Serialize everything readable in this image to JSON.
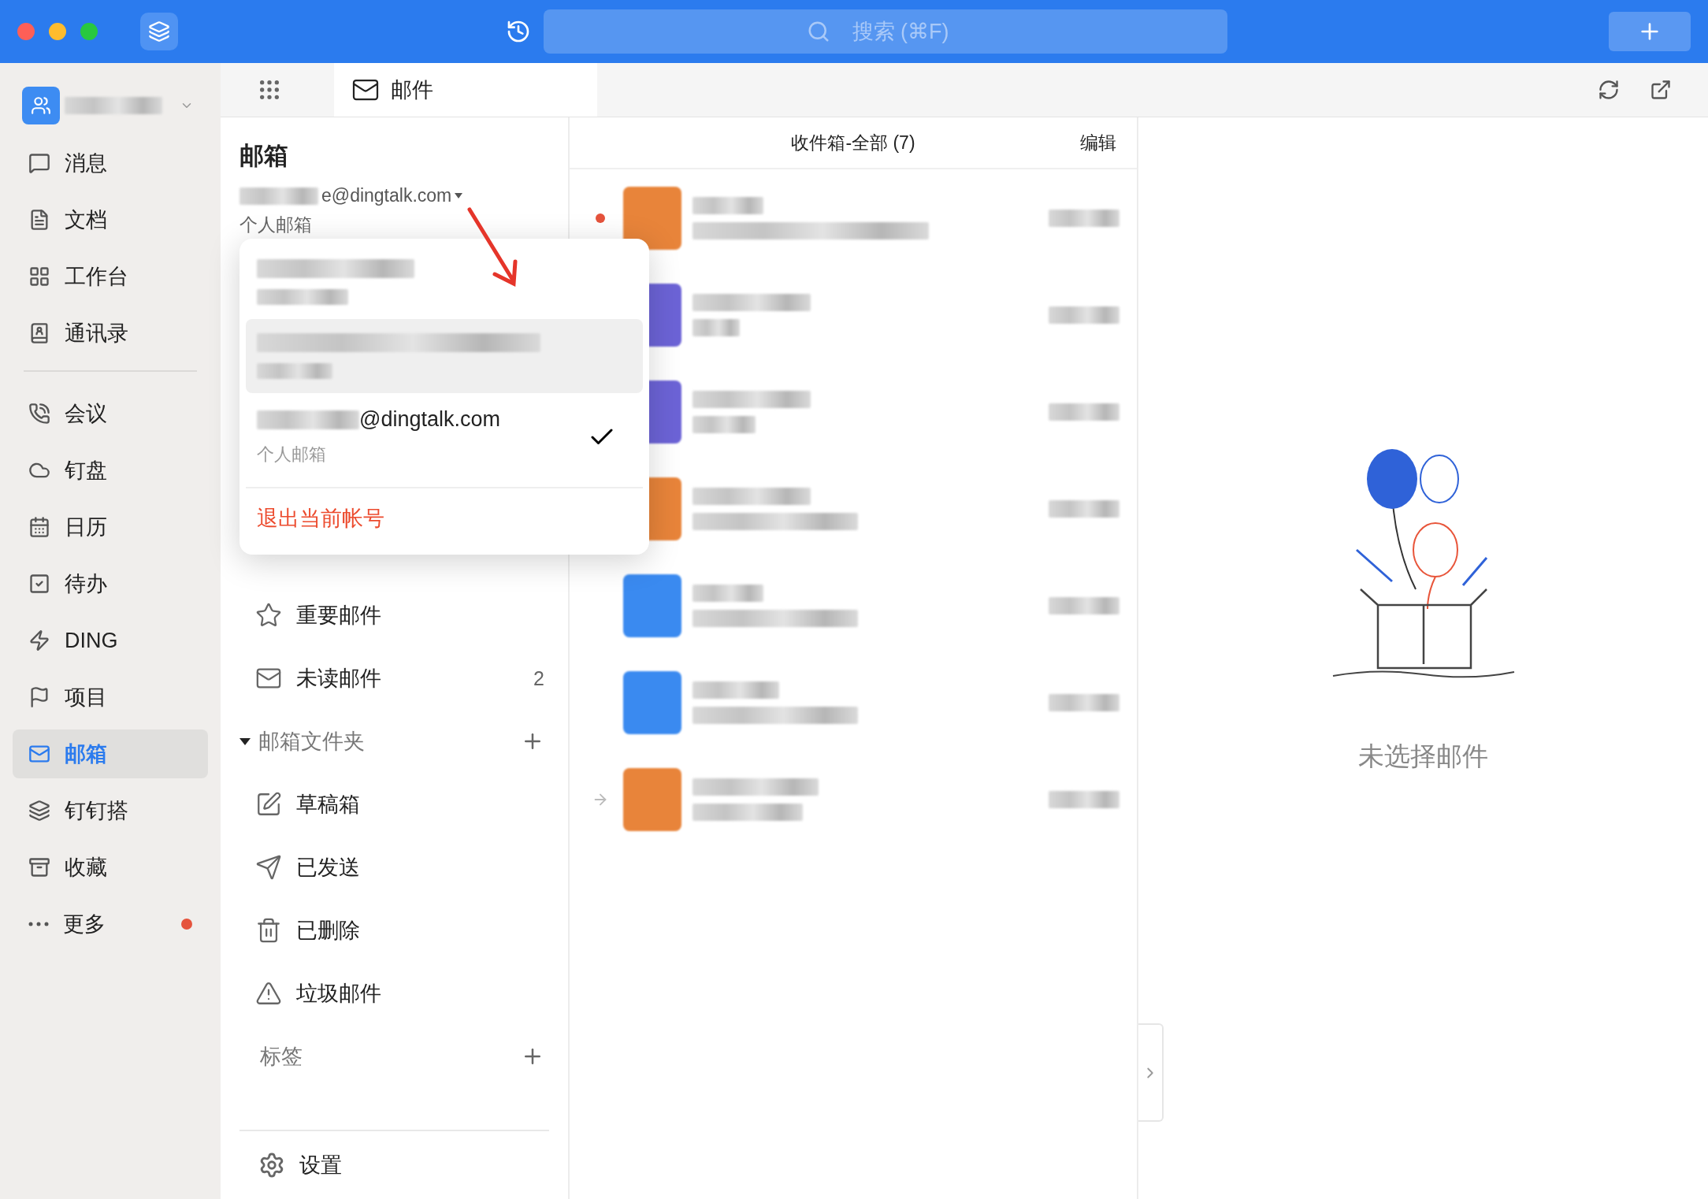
{
  "search": {
    "placeholder": "搜索 (⌘F)"
  },
  "tabs": [
    {
      "label": "邮件",
      "selected": true
    }
  ],
  "sidebar": {
    "items": [
      {
        "label": "消息",
        "selected": false,
        "dot": false
      },
      {
        "label": "文档",
        "selected": false,
        "dot": false
      },
      {
        "label": "工作台",
        "selected": false,
        "dot": false
      },
      {
        "label": "通讯录",
        "selected": false,
        "dot": false
      },
      {
        "label": "会议",
        "selected": false,
        "dot": false
      },
      {
        "label": "钉盘",
        "selected": false,
        "dot": false
      },
      {
        "label": "日历",
        "selected": false,
        "dot": false
      },
      {
        "label": "待办",
        "selected": false,
        "dot": false
      },
      {
        "label": "DING",
        "selected": false,
        "dot": false
      },
      {
        "label": "项目",
        "selected": false,
        "dot": false
      },
      {
        "label": "邮箱",
        "selected": true,
        "dot": false
      },
      {
        "label": "钉钉搭",
        "selected": false,
        "dot": false
      },
      {
        "label": "收藏",
        "selected": false,
        "dot": false
      },
      {
        "label": "更多",
        "selected": false,
        "dot": true
      }
    ]
  },
  "mailbox": {
    "title": "邮箱",
    "account": "e@dingtalk.com",
    "account_type": "个人邮箱",
    "quick_items": [
      {
        "label": "重要邮件"
      },
      {
        "label": "未读邮件",
        "count": "2"
      }
    ],
    "folders": {
      "label": "邮箱文件夹",
      "expanded": true,
      "items": [
        {
          "label": "草稿箱"
        },
        {
          "label": "已发送"
        },
        {
          "label": "已删除"
        },
        {
          "label": "垃圾邮件"
        }
      ]
    },
    "tags": {
      "label": "标签"
    },
    "settings": "设置"
  },
  "account_menu": {
    "accounts": [
      {
        "selected": false,
        "highlighted": false
      },
      {
        "selected": false,
        "highlighted": true
      },
      {
        "address": "@dingtalk.com",
        "type": "个人邮箱",
        "selected": true,
        "highlighted": false
      }
    ],
    "logout": "退出当前帐号"
  },
  "mail_list": {
    "title": "收件箱-全部 (7)",
    "edit": "编辑",
    "rows": [
      {
        "color": "#e8843a",
        "unread": true,
        "forwarded": false
      },
      {
        "color": "#6c63d6",
        "unread": false,
        "forwarded": false
      },
      {
        "color": "#6c63d6",
        "unread": false,
        "forwarded": false
      },
      {
        "color": "#e8843a",
        "unread": false,
        "forwarded": false
      },
      {
        "color": "#3a8af0",
        "unread": false,
        "forwarded": false
      },
      {
        "color": "#3a8af0",
        "unread": false,
        "forwarded": false
      },
      {
        "color": "#e8843a",
        "unread": false,
        "forwarded": true
      }
    ]
  },
  "preview": {
    "empty_text": "未选择邮件"
  }
}
